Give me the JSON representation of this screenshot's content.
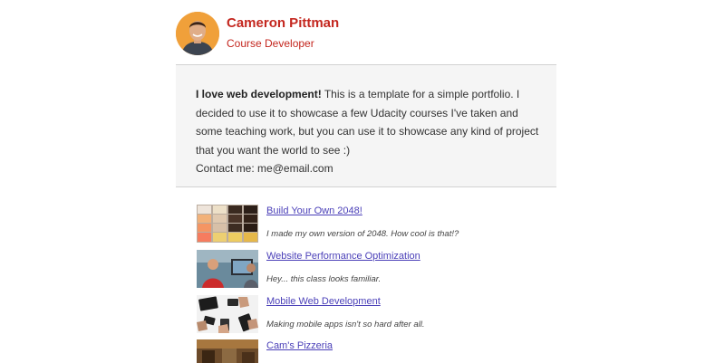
{
  "profile": {
    "name": "Cameron Pittman",
    "role": "Course Developer"
  },
  "bio": {
    "lead": "I love web development!",
    "text": " This is a template for a simple portfolio. I decided to use it to showcase a few Udacity courses I've taken and some teaching work, but you can use it to showcase any kind of project that you want the world to see :)",
    "contact_label": "Contact me:",
    "contact_email": "me@email.com"
  },
  "projects": [
    {
      "title": "Build Your Own 2048!",
      "description": "I made my own version of 2048. How cool is that!?"
    },
    {
      "title": "Website Performance Optimization",
      "description": "Hey... this class looks familiar."
    },
    {
      "title": "Mobile Web Development",
      "description": "Making mobile apps isn't so hard after all."
    },
    {
      "title": "Cam's Pizzeria",
      "description": ""
    }
  ],
  "colors": {
    "name": "#c4271f",
    "link": "#4a3fb8",
    "bio_background": "#f5f5f5"
  }
}
